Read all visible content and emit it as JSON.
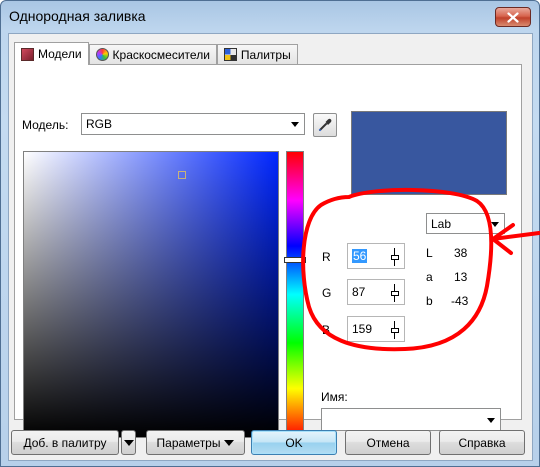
{
  "window": {
    "title": "Однородная заливка"
  },
  "tabs": [
    {
      "label": "Модели",
      "icon": "models-icon"
    },
    {
      "label": "Краскосмесители",
      "icon": "mixers-icon"
    },
    {
      "label": "Палитры",
      "icon": "palettes-icon"
    }
  ],
  "model": {
    "label": "Модель:",
    "value": "RGB"
  },
  "preview_color": "#38579f",
  "lab_mode": {
    "value": "Lab"
  },
  "rgb": {
    "r_label": "R",
    "r_value": "56",
    "g_label": "G",
    "g_value": "87",
    "b_label": "B",
    "b_value": "159"
  },
  "lab": {
    "l_label": "L",
    "l_value": "38",
    "a_label": "a",
    "a_value": "13",
    "b_label": "b",
    "b_value": "-43"
  },
  "name_field": {
    "label": "Имя:",
    "value": ""
  },
  "buttons": {
    "add_to_palette": "Доб. в палитру",
    "parameters": "Параметры",
    "ok": "OK",
    "cancel": "Отмена",
    "help": "Справка"
  },
  "colors": {
    "annotation": "#ff0000",
    "window_frame": "#b7d0ea"
  }
}
